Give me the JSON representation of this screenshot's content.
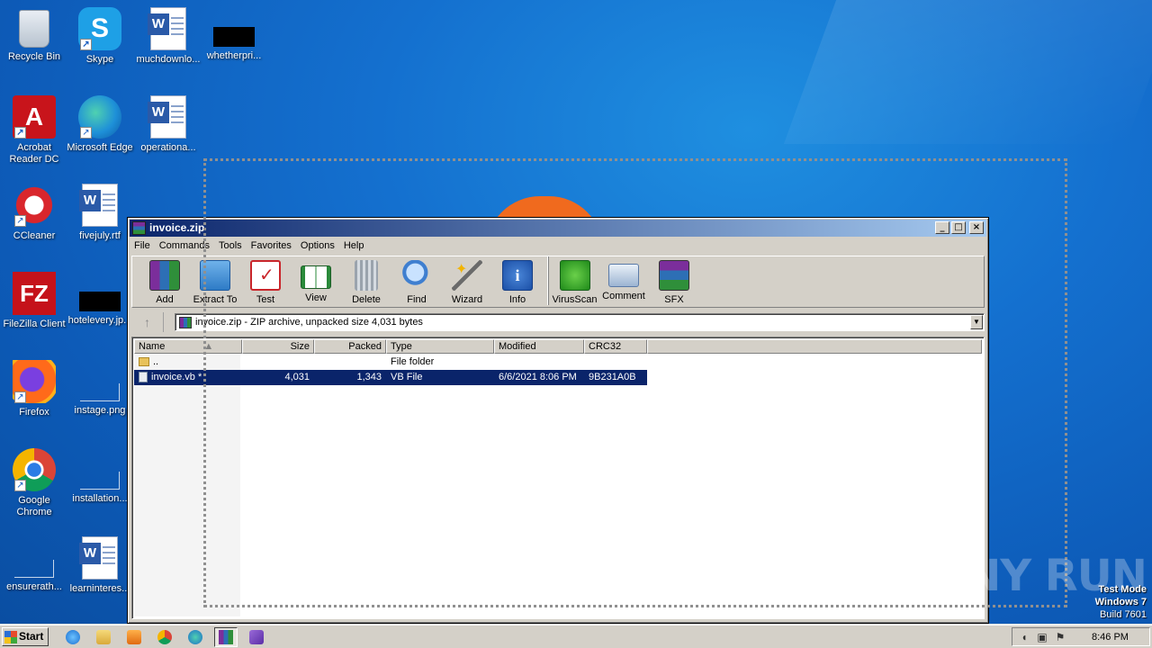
{
  "desktop": {
    "icons": [
      {
        "label": "Recycle Bin",
        "icon": "recycle-bin-icon"
      },
      {
        "label": "Skype",
        "icon": "skype-icon"
      },
      {
        "label": "muchdownlo...",
        "icon": "word-document-icon"
      },
      {
        "label": "whetherpri...",
        "icon": "black-thumbnail-icon"
      },
      {
        "label": "Acrobat Reader DC",
        "icon": "acrobat-reader-icon"
      },
      {
        "label": "Microsoft Edge",
        "icon": "edge-icon"
      },
      {
        "label": "operationa...",
        "icon": "word-document-icon"
      },
      {
        "label": "CCleaner",
        "icon": "ccleaner-icon"
      },
      {
        "label": "fivejuly.rtf",
        "icon": "word-document-icon"
      },
      {
        "label": "FileZilla Client",
        "icon": "filezilla-icon"
      },
      {
        "label": "hotelevery.jp...",
        "icon": "black-thumbnail-icon"
      },
      {
        "label": "Firefox",
        "icon": "firefox-icon"
      },
      {
        "label": "instage.png",
        "icon": "blank-image-icon"
      },
      {
        "label": "Google Chrome",
        "icon": "chrome-icon"
      },
      {
        "label": "installation...",
        "icon": "blank-image-icon"
      },
      {
        "label": "ensurerath...",
        "icon": "blank-image-icon"
      },
      {
        "label": "learninteres...",
        "icon": "word-document-icon"
      }
    ]
  },
  "window": {
    "title": "invoice.zip",
    "menu": [
      "File",
      "Commands",
      "Tools",
      "Favorites",
      "Options",
      "Help"
    ],
    "toolbar": [
      {
        "label": "Add",
        "icon": "add-archive-icon"
      },
      {
        "label": "Extract To",
        "icon": "extract-folder-icon"
      },
      {
        "label": "Test",
        "icon": "test-checklist-icon"
      },
      {
        "label": "View",
        "icon": "view-book-icon"
      },
      {
        "label": "Delete",
        "icon": "trash-can-icon"
      },
      {
        "label": "Find",
        "icon": "magnifier-icon"
      },
      {
        "label": "Wizard",
        "icon": "magic-wand-icon"
      },
      {
        "label": "Info",
        "icon": "info-icon"
      },
      {
        "label": "VirusScan",
        "icon": "virus-scan-icon"
      },
      {
        "label": "Comment",
        "icon": "comment-icon"
      },
      {
        "label": "SFX",
        "icon": "sfx-archive-icon"
      }
    ],
    "path": "invoice.zip - ZIP archive, unpacked size 4,031 bytes",
    "columns": [
      "Name",
      "Size",
      "Packed",
      "Type",
      "Modified",
      "CRC32"
    ],
    "rows": [
      {
        "name": "..",
        "size": "",
        "packed": "",
        "type": "File folder",
        "modified": "",
        "crc": ""
      },
      {
        "name": "invoice.vb *",
        "size": "4,031",
        "packed": "1,343",
        "type": "VB File",
        "modified": "6/6/2021 8:06 PM",
        "crc": "9B231A0B"
      }
    ]
  },
  "watermark": "ANY RUN",
  "testmode": {
    "line1": "Test Mode",
    "line2": "Windows 7",
    "line3": "Build 7601"
  },
  "taskbar": {
    "start_label": "Start",
    "clock": "8:46 PM",
    "quick_launch": [
      "ie-icon",
      "explorer-icon",
      "media-player-icon",
      "chrome-icon",
      "edge-icon",
      "winrar-icon",
      "visual-studio-icon"
    ]
  }
}
